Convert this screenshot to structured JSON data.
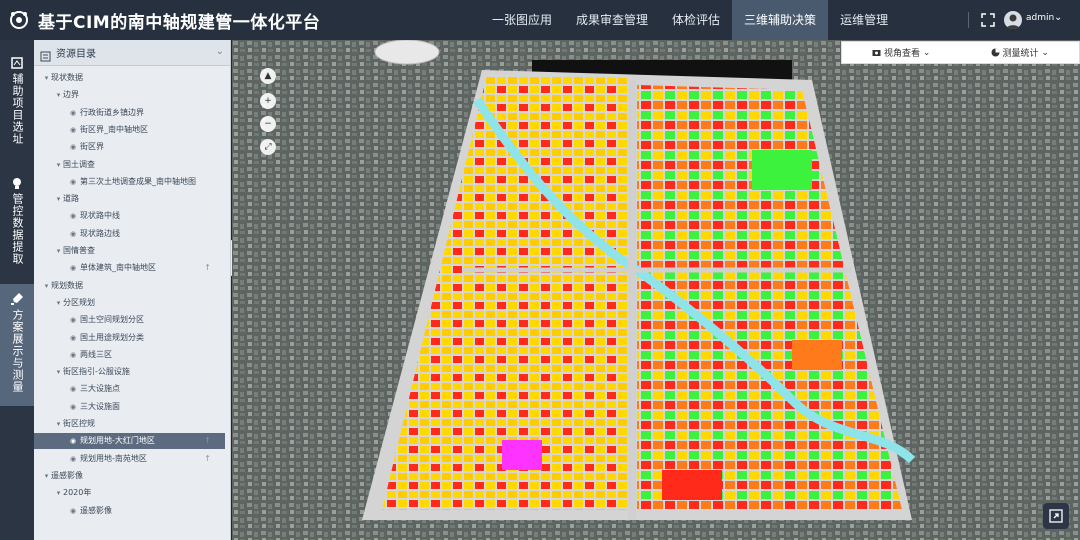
{
  "header": {
    "title": "基于CIM的南中轴规建管一体化平台",
    "nav": [
      "一张图应用",
      "成果审查管理",
      "体检评估",
      "三维辅助决策",
      "运维管理"
    ],
    "active_nav": "三维辅助决策",
    "user": "admin"
  },
  "sidebar_tabs": [
    {
      "label": "辅助项目选址",
      "icon": "pin-icon"
    },
    {
      "label": "管控数据提取",
      "icon": "bulb-icon"
    },
    {
      "label": "方案展示与测量",
      "icon": "brush-icon",
      "active": true
    }
  ],
  "panel": {
    "title": "资源目录",
    "tree": [
      {
        "label": "现状数据",
        "level": 0,
        "type": "folder"
      },
      {
        "label": "边界",
        "level": 1,
        "type": "folder"
      },
      {
        "label": "行政街道乡镇边界",
        "level": 2,
        "type": "layer"
      },
      {
        "label": "街区界_南中轴地区",
        "level": 2,
        "type": "layer"
      },
      {
        "label": "街区界",
        "level": 2,
        "type": "layer"
      },
      {
        "label": "国土调查",
        "level": 1,
        "type": "folder"
      },
      {
        "label": "第三次土地调查成果_南中轴地图",
        "level": 2,
        "type": "layer"
      },
      {
        "label": "道路",
        "level": 1,
        "type": "folder"
      },
      {
        "label": "现状路中线",
        "level": 2,
        "type": "layer"
      },
      {
        "label": "现状路边线",
        "level": 2,
        "type": "layer"
      },
      {
        "label": "国情普查",
        "level": 1,
        "type": "folder"
      },
      {
        "label": "单体建筑_南中轴地区",
        "level": 2,
        "type": "layer",
        "pin": true
      },
      {
        "label": "规划数据",
        "level": 0,
        "type": "folder"
      },
      {
        "label": "分区规划",
        "level": 1,
        "type": "folder"
      },
      {
        "label": "国土空间规划分区",
        "level": 2,
        "type": "layer"
      },
      {
        "label": "国土用途规划分类",
        "level": 2,
        "type": "layer"
      },
      {
        "label": "两线三区",
        "level": 2,
        "type": "layer"
      },
      {
        "label": "街区指引-公服设施",
        "level": 1,
        "type": "folder"
      },
      {
        "label": "三大设施点",
        "level": 2,
        "type": "layer"
      },
      {
        "label": "三大设施面",
        "level": 2,
        "type": "layer"
      },
      {
        "label": "街区控规",
        "level": 1,
        "type": "folder"
      },
      {
        "label": "规划用地-大红门地区",
        "level": 2,
        "type": "layer",
        "pin": true,
        "selected": true
      },
      {
        "label": "规划用地-南苑地区",
        "level": 2,
        "type": "layer",
        "pin": true
      },
      {
        "label": "遥感影像",
        "level": 0,
        "type": "folder"
      },
      {
        "label": "2020年",
        "level": 1,
        "type": "folder"
      },
      {
        "label": "遥感影像",
        "level": 2,
        "type": "layer"
      }
    ]
  },
  "toolbar": {
    "view_label": "视角查看",
    "measure_label": "测量统计"
  },
  "colors": {
    "header_bg": "#26303f",
    "active_nav_bg": "#4a5a6e",
    "panel_bg": "#e9edf2",
    "selected_row": "#5c6b80",
    "land_residential": "#ffd800",
    "land_commercial": "#ff2a1a",
    "land_green": "#3cf23c",
    "land_industrial": "#ff7a1a",
    "land_water": "#34d9e8",
    "land_public": "#ff33ff"
  }
}
